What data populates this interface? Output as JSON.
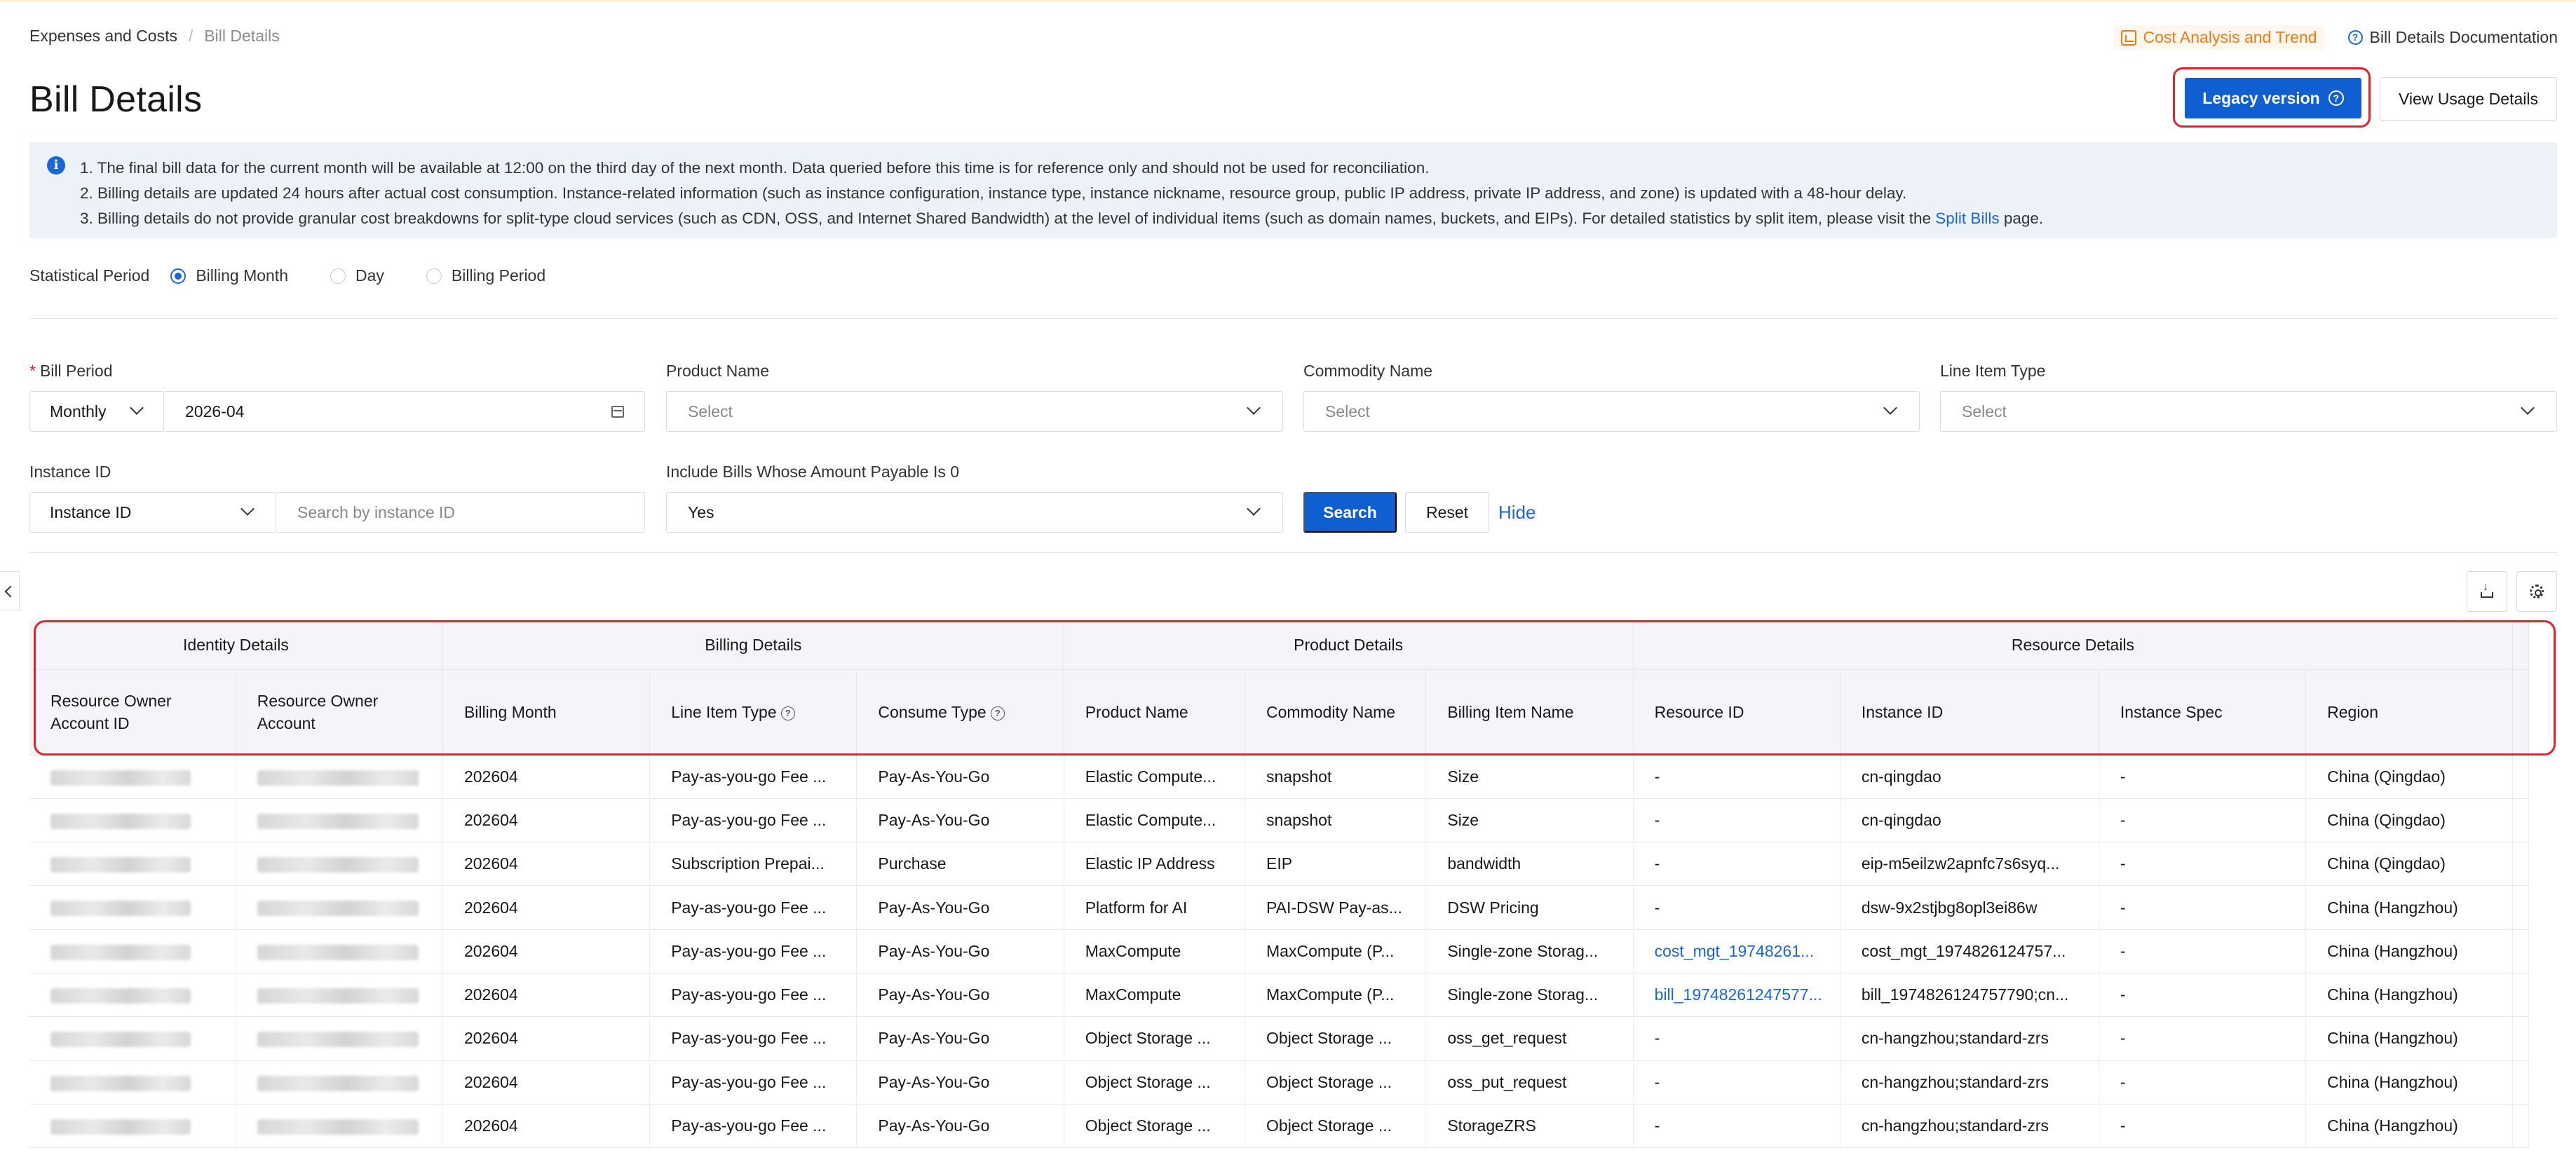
{
  "breadcrumb": {
    "parent": "Expenses and Costs",
    "sep": "/",
    "current": "Bill Details"
  },
  "top_links": {
    "cost_analysis": "Cost Analysis and Trend",
    "documentation": "Bill Details Documentation"
  },
  "page_title": "Bill Details",
  "header_buttons": {
    "legacy": "Legacy version",
    "usage": "View Usage Details"
  },
  "notice": {
    "line1": "1. The final bill data for the current month will be available at 12:00 on the third day of the next month. Data queried before this time is for reference only and should not be used for reconciliation.",
    "line2": "2. Billing details are updated 24 hours after actual cost consumption. Instance-related information (such as instance configuration, instance type, instance nickname, resource group, public IP address, private IP address, and zone) is updated with a 48-hour delay.",
    "line3_pre": "3. Billing details do not provide granular cost breakdowns for split-type cloud services (such as CDN, OSS, and Internet Shared Bandwidth) at the level of individual items (such as domain names, buckets, and EIPs). For detailed statistics by split item, please visit the",
    "line3_link": "Split Bills",
    "line3_post": "page."
  },
  "statistical_period": {
    "label": "Statistical Period",
    "options": [
      "Billing Month",
      "Day",
      "Billing Period"
    ],
    "selected": "Billing Month"
  },
  "filters": {
    "bill_period_label": "Bill Period",
    "bill_period_mode": "Monthly",
    "bill_period_value": "2026-04",
    "product_name_label": "Product Name",
    "commodity_name_label": "Commodity Name",
    "line_item_type_label": "Line Item Type",
    "select_placeholder": "Select",
    "instance_id_label": "Instance ID",
    "instance_id_mode": "Instance ID",
    "instance_id_placeholder": "Search by instance ID",
    "zero_amount_label": "Include Bills Whose Amount Payable Is 0",
    "zero_amount_value": "Yes",
    "search": "Search",
    "reset": "Reset",
    "hide": "Hide"
  },
  "table": {
    "groups": [
      "Identity Details",
      "Billing Details",
      "Product Details",
      "Resource Details"
    ],
    "columns": [
      "Resource Owner Account ID",
      "Resource Owner Account",
      "Billing Month",
      "Line Item Type",
      "Consume Type",
      "Product Name",
      "Commodity Name",
      "Billing Item Name",
      "Resource ID",
      "Instance ID",
      "Instance Spec",
      "Region"
    ],
    "rows": [
      [
        "202604",
        "Pay-as-you-go Fee ...",
        "Pay-As-You-Go",
        "Elastic Compute...",
        "snapshot",
        "Size",
        "-",
        "cn-qingdao",
        "-",
        "China (Qingdao)"
      ],
      [
        "202604",
        "Pay-as-you-go Fee ...",
        "Pay-As-You-Go",
        "Elastic Compute...",
        "snapshot",
        "Size",
        "-",
        "cn-qingdao",
        "-",
        "China (Qingdao)"
      ],
      [
        "202604",
        "Subscription Prepai...",
        "Purchase",
        "Elastic IP Address",
        "EIP",
        "bandwidth",
        "-",
        "eip-m5eilzw2apnfc7s6syq...",
        "-",
        "China (Qingdao)"
      ],
      [
        "202604",
        "Pay-as-you-go Fee ...",
        "Pay-As-You-Go",
        "Platform for AI",
        "PAI-DSW Pay-as...",
        "DSW Pricing",
        "-",
        "dsw-9x2stjbg8opl3ei86w",
        "-",
        "China (Hangzhou)"
      ],
      [
        "202604",
        "Pay-as-you-go Fee ...",
        "Pay-As-You-Go",
        "MaxCompute",
        "MaxCompute (P...",
        "Single-zone Storag...",
        "cost_mgt_19748261...",
        "cost_mgt_1974826124757...",
        "-",
        "China (Hangzhou)"
      ],
      [
        "202604",
        "Pay-as-you-go Fee ...",
        "Pay-As-You-Go",
        "MaxCompute",
        "MaxCompute (P...",
        "Single-zone Storag...",
        "bill_19748261247577...",
        "bill_1974826124757790;cn...",
        "-",
        "China (Hangzhou)"
      ],
      [
        "202604",
        "Pay-as-you-go Fee ...",
        "Pay-As-You-Go",
        "Object Storage ...",
        "Object Storage ...",
        "oss_get_request",
        "-",
        "cn-hangzhou;standard-zrs",
        "-",
        "China (Hangzhou)"
      ],
      [
        "202604",
        "Pay-as-you-go Fee ...",
        "Pay-As-You-Go",
        "Object Storage ...",
        "Object Storage ...",
        "oss_put_request",
        "-",
        "cn-hangzhou;standard-zrs",
        "-",
        "China (Hangzhou)"
      ],
      [
        "202604",
        "Pay-as-you-go Fee ...",
        "Pay-As-You-Go",
        "Object Storage ...",
        "Object Storage ...",
        "StorageZRS",
        "-",
        "cn-hangzhou;standard-zrs",
        "-",
        "China (Hangzhou)"
      ]
    ]
  },
  "colors": {
    "primary": "#0f5fd3",
    "highlight": "#e3232b",
    "accent_orange": "#f07b16",
    "notice_bg": "#edf1f8"
  }
}
